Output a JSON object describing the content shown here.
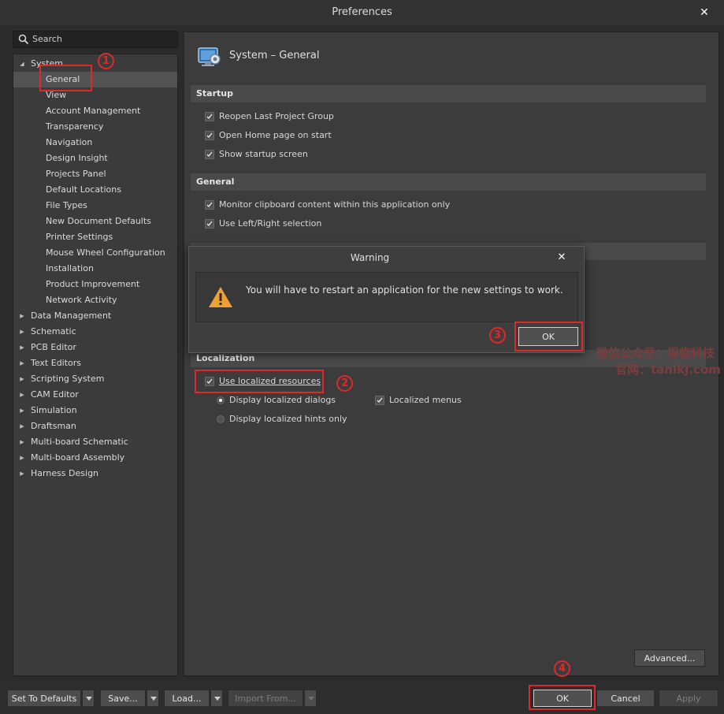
{
  "window": {
    "title": "Preferences"
  },
  "search": {
    "placeholder": "Search"
  },
  "tree": {
    "system": {
      "label": "System",
      "children": [
        "General",
        "View",
        "Account Management",
        "Transparency",
        "Navigation",
        "Design Insight",
        "Projects Panel",
        "Default Locations",
        "File Types",
        "New Document Defaults",
        "Printer Settings",
        "Mouse Wheel Configuration",
        "Installation",
        "Product Improvement",
        "Network Activity"
      ]
    },
    "categories": [
      "Data Management",
      "Schematic",
      "PCB Editor",
      "Text Editors",
      "Scripting System",
      "CAM Editor",
      "Simulation",
      "Draftsman",
      "Multi-board Schematic",
      "Multi-board Assembly",
      "Harness Design"
    ]
  },
  "page": {
    "heading": "System – General",
    "startup": {
      "title": "Startup",
      "options": [
        {
          "label": "Reopen Last Project Group",
          "checked": true
        },
        {
          "label": "Open Home page on start",
          "checked": true
        },
        {
          "label": "Show startup screen",
          "checked": true
        }
      ]
    },
    "general": {
      "title": "General",
      "options": [
        {
          "label": "Monitor clipboard content within this application only",
          "checked": true
        },
        {
          "label": "Use Left/Right selection",
          "checked": true
        }
      ]
    },
    "localization": {
      "title": "Localization",
      "use_localized": {
        "label": "Use localized resources",
        "checked": true
      },
      "radio_dialogs": {
        "label": "Display localized dialogs",
        "selected": true
      },
      "radio_hints": {
        "label": "Display localized hints only",
        "selected": false
      },
      "localized_menus": {
        "label": "Localized menus",
        "checked": true
      }
    },
    "advanced_label": "Advanced..."
  },
  "warning": {
    "title": "Warning",
    "message": "You will have to restart an application for the new settings to work.",
    "ok_label": "OK"
  },
  "footer": {
    "set_defaults": "Set To Defaults",
    "save": "Save...",
    "load": "Load...",
    "import_from": "Import From...",
    "ok": "OK",
    "cancel": "Cancel",
    "apply": "Apply"
  },
  "annotations": {
    "n1": "1",
    "n2": "2",
    "n3": "3",
    "n4": "4"
  },
  "watermark": {
    "line1": "微信公众号：探临科技",
    "line2": "官网：tanlkj.com"
  },
  "colors": {
    "highlight": "#e0282a",
    "warning_icon": "#f0a030",
    "bg": "#2b2b2b"
  }
}
